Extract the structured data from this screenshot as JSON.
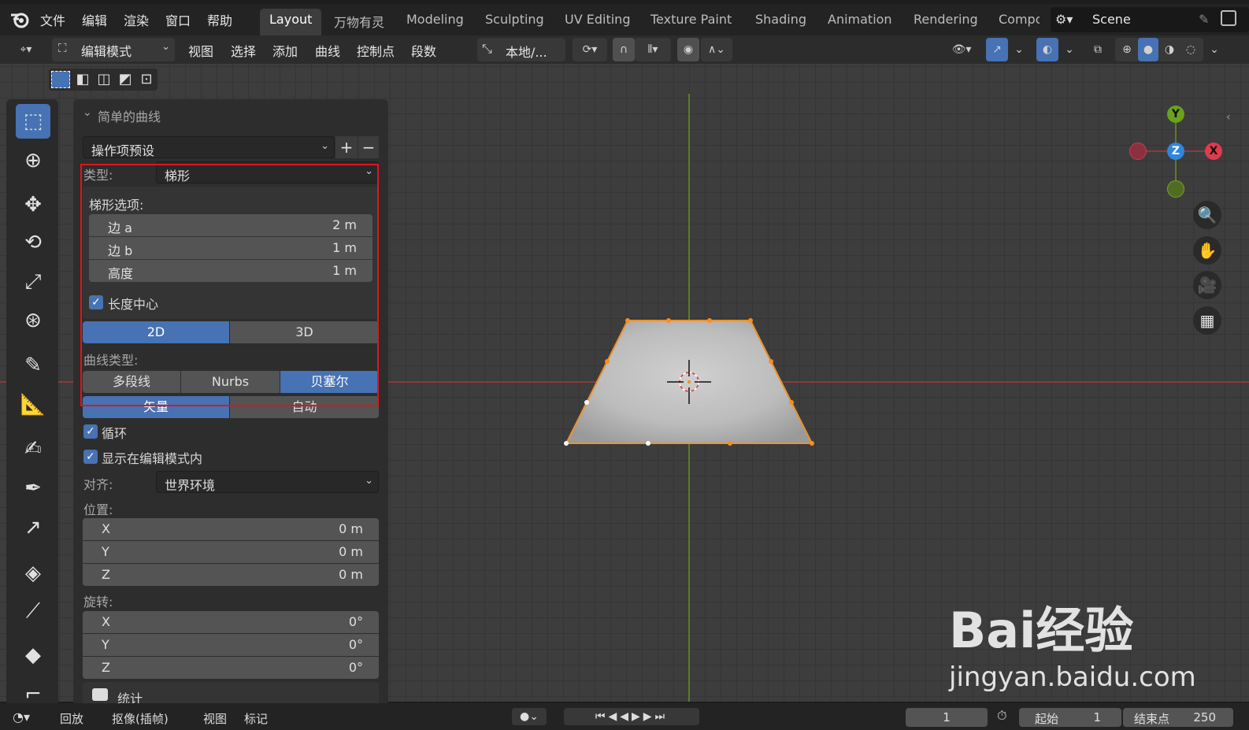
{
  "topbar": {
    "menus": [
      "文件",
      "编辑",
      "渲染",
      "窗口",
      "帮助"
    ],
    "workspaces": [
      "Layout",
      "万物有灵",
      "Modeling",
      "Sculpting",
      "UV Editing",
      "Texture Paint",
      "Shading",
      "Animation",
      "Rendering",
      "Compo"
    ],
    "active_workspace": "Layout",
    "scene": "Scene"
  },
  "header": {
    "mode": "编辑模式",
    "menus": [
      "视图",
      "选择",
      "添加",
      "曲线",
      "控制点",
      "段数"
    ],
    "transform_orientation": "本地/..."
  },
  "panel": {
    "title": "简单的曲线",
    "preset": "操作项预设",
    "type_label": "类型:",
    "type_value": "梯形",
    "options_label": "梯形选项:",
    "fields": [
      {
        "label": "边 a",
        "value": "2 m"
      },
      {
        "label": "边 b",
        "value": "1 m"
      },
      {
        "label": "高度",
        "value": "1 m"
      }
    ],
    "center_checkbox": "长度中心",
    "dim_2d": "2D",
    "dim_3d": "3D",
    "curve_type_label": "曲线类型:",
    "curve_types": [
      "多段线",
      "Nurbs",
      "贝塞尔"
    ],
    "handle_types": [
      "矢量",
      "自动"
    ],
    "loop_checkbox": "循环",
    "show_edit_checkbox": "显示在编辑模式内",
    "align_label": "对齐:",
    "align_value": "世界环境",
    "location_label": "位置:",
    "location": [
      {
        "label": "X",
        "value": "0 m"
      },
      {
        "label": "Y",
        "value": "0 m"
      },
      {
        "label": "Z",
        "value": "0 m"
      }
    ],
    "rotation_label": "旋转:",
    "rotation": [
      {
        "label": "X",
        "value": "0°"
      },
      {
        "label": "Y",
        "value": "0°"
      },
      {
        "label": "Z",
        "value": "0°"
      }
    ],
    "stats_label": "统计"
  },
  "gizmo": {
    "x": "X",
    "y": "Y",
    "z": "Z"
  },
  "bottombar": {
    "playback": "回放",
    "keying": "抠像(插帧)",
    "view": "视图",
    "marker": "标记",
    "current_frame": "1",
    "start_label": "起始",
    "start_value": "1",
    "end_label": "结束点",
    "end_value": "250"
  },
  "watermark": {
    "brand": "Bai经验",
    "url": "jingyan.baidu.com"
  },
  "colors": {
    "accent": "#4772b3",
    "highlight_box": "#e0151d",
    "curve_vertex": "#ff8c1a"
  }
}
